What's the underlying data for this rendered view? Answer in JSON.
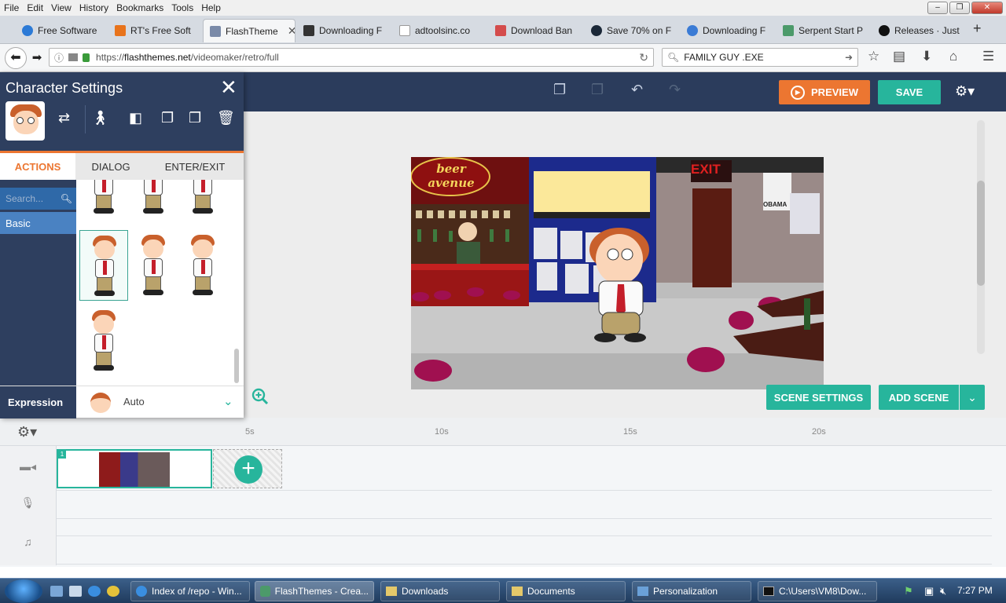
{
  "menu": {
    "items": [
      "File",
      "Edit",
      "View",
      "History",
      "Bookmarks",
      "Tools",
      "Help"
    ]
  },
  "tabs": [
    {
      "label": "Free Software",
      "color": "#2c7ad6"
    },
    {
      "label": "RT's Free Soft",
      "color": "#e8731b"
    },
    {
      "label": "FlashTheme",
      "color": "#7a8aa8",
      "active": true
    },
    {
      "label": "Downloading F",
      "color": "#333333"
    },
    {
      "label": "adtoolsinc.co",
      "color": "#ffffff"
    },
    {
      "label": "Download Ban",
      "color": "#d44c4c"
    },
    {
      "label": "Save 70% on F",
      "color": "#1b2838"
    },
    {
      "label": "Downloading F",
      "color": "#3a7bd5"
    },
    {
      "label": "Serpent Start P",
      "color": "#4c9a6a"
    },
    {
      "label": "Releases · Just",
      "color": "#111111"
    }
  ],
  "nav": {
    "url_prefix": "https://",
    "url_domain": "flashthemes.net",
    "url_path": "/videomaker/retro/full",
    "search_value": "FAMILY GUY .EXE"
  },
  "app": {
    "preview_label": "PREVIEW",
    "save_label": "SAVE"
  },
  "panel": {
    "title": "Character Settings",
    "tabs": [
      "ACTIONS",
      "DIALOG",
      "ENTER/EXIT"
    ],
    "search_placeholder": "Search...",
    "category": "Basic",
    "expression_label": "Expression",
    "expression_value": "Auto"
  },
  "scene": {
    "sign_text": "beer avenue",
    "exit_text": "EXIT",
    "poster_text": "OBAMA",
    "scene_settings_label": "SCENE SETTINGS",
    "add_scene_label": "ADD SCENE"
  },
  "timeline": {
    "ticks": [
      "5s",
      "10s",
      "15s",
      "20s"
    ],
    "clip_number": "1"
  },
  "taskbar": {
    "items": [
      {
        "label": "Index of /repo - Win..."
      },
      {
        "label": "FlashThemes - Crea...",
        "active": true
      },
      {
        "label": "Downloads"
      },
      {
        "label": "Documents"
      },
      {
        "label": "Personalization"
      },
      {
        "label": "C:\\Users\\VM8\\Dow..."
      }
    ],
    "time": "7:27 PM"
  }
}
